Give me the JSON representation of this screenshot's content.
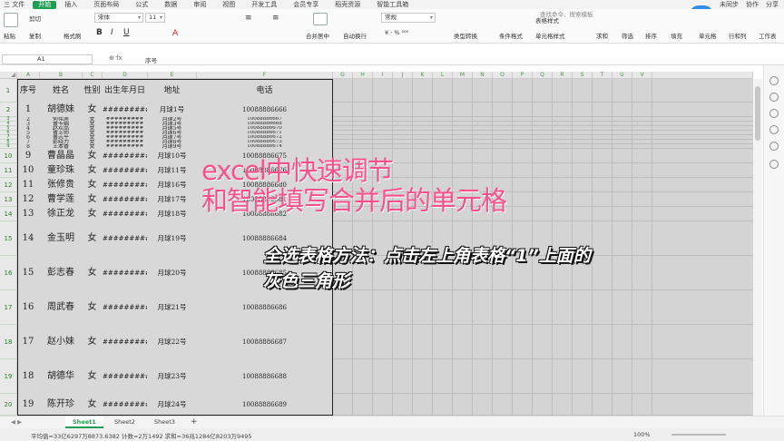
{
  "menu": {
    "file": "三 文件",
    "items": [
      "开始",
      "插入",
      "页面布局",
      "公式",
      "数据",
      "审阅",
      "视图",
      "开发工具",
      "会员专享",
      "稻壳资源",
      "智能工具箱"
    ],
    "active_index": 0,
    "right": [
      "未同步",
      "协作",
      "分享"
    ]
  },
  "time_badge": "00:45",
  "ribbon": {
    "cut": "剪切",
    "copy": "复制",
    "format_painter": "格式刷",
    "paste": "粘贴",
    "font": "宋体",
    "font_size": "11",
    "merge": "合并居中",
    "wrap": "自动换行",
    "number_format": "常规",
    "type_convert": "类型转换",
    "cond_format": "条件格式",
    "table_style": "表格样式",
    "cell_style": "单元格样式",
    "sum": "求和",
    "filter": "筛选",
    "sort": "排序",
    "fill": "填充",
    "cell": "单元格",
    "rowcol": "行和列",
    "worksheet": "工作表",
    "search": "查找命令、搜索模板"
  },
  "formula_bar": {
    "name_box": "A1",
    "fx": "fx",
    "value": "序号"
  },
  "columns": [
    "A",
    "B",
    "C",
    "D",
    "E",
    "F",
    "G",
    "H",
    "I",
    "J",
    "K",
    "L",
    "M",
    "N",
    "O",
    "P",
    "Q",
    "R",
    "S",
    "T",
    "U",
    "V"
  ],
  "row_numbers": [
    "1",
    "2",
    "3",
    "4",
    "5",
    "6",
    "7",
    "8",
    "9",
    "10",
    "11",
    "12",
    "13",
    "14",
    "15",
    "16",
    "17",
    "18",
    "19",
    "20"
  ],
  "table": {
    "headers": [
      "序号",
      "姓名",
      "性别",
      "出生年月日",
      "地址",
      "电话"
    ],
    "rows": [
      [
        "1",
        "胡德妹",
        "女",
        "#########",
        "月球1号",
        "10088886666"
      ],
      [
        "2",
        "何伟莲",
        "女",
        "#########",
        "月球2号",
        "10088886667"
      ],
      [
        "3",
        "曹卡娟",
        "女",
        "#########",
        "月球3号",
        "10088886668"
      ],
      [
        "4",
        "赵欢品",
        "女",
        "#########",
        "月球5号",
        "10088886670"
      ],
      [
        "5",
        "曹王师",
        "女",
        "#########",
        "月球6号",
        "10088886671"
      ],
      [
        "6",
        "曹志平",
        "女",
        "#########",
        "月球7号",
        "10088886672"
      ],
      [
        "7",
        "彭晓力",
        "女",
        "#########",
        "月球8号",
        "10088886673"
      ],
      [
        "8",
        "王本香",
        "女",
        "#########",
        "月球9号",
        "10088886674"
      ],
      [
        "9",
        "曹晶晶",
        "女",
        "#########",
        "月球10号",
        "10088886675"
      ],
      [
        "10",
        "童珍珠",
        "女",
        "#########",
        "月球11号",
        "10088886676"
      ],
      [
        "11",
        "张修贵",
        "女",
        "#########",
        "月球16号",
        "10088886680"
      ],
      [
        "12",
        "曹学莲",
        "女",
        "#########",
        "月球17号",
        "10088886681"
      ],
      [
        "13",
        "徐正龙",
        "女",
        "#########",
        "月球18号",
        "10088886682"
      ],
      [
        "14",
        "金玉明",
        "女",
        "#########",
        "月球19号",
        "10088886684"
      ],
      [
        "15",
        "彭志春",
        "女",
        "#########",
        "月球20号",
        "10088886685"
      ],
      [
        "16",
        "周武春",
        "女",
        "#########",
        "月球21号",
        "10088886686"
      ],
      [
        "17",
        "赵小妹",
        "女",
        "#########",
        "月球22号",
        "10088886687"
      ],
      [
        "18",
        "胡德华",
        "女",
        "#########",
        "月球23号",
        "10088886688"
      ],
      [
        "19",
        "陈开珍",
        "女",
        "#########",
        "月球24号",
        "10088886689"
      ]
    ]
  },
  "overlay": {
    "title_line1": "excel中快速调节",
    "title_line2": "和智能填写合并后的单元格",
    "tip_line1": "全选表格方法：点击左上角表格“1”上面的",
    "tip_line2": "灰色三角形"
  },
  "sheets": [
    "Sheet1",
    "Sheet2",
    "Sheet3"
  ],
  "active_sheet": 0,
  "status": {
    "summary": "平均值=33亿6297万8873.6382  计数=2万1492  求和=36兆1284亿8203万9495",
    "zoom": "100%"
  }
}
